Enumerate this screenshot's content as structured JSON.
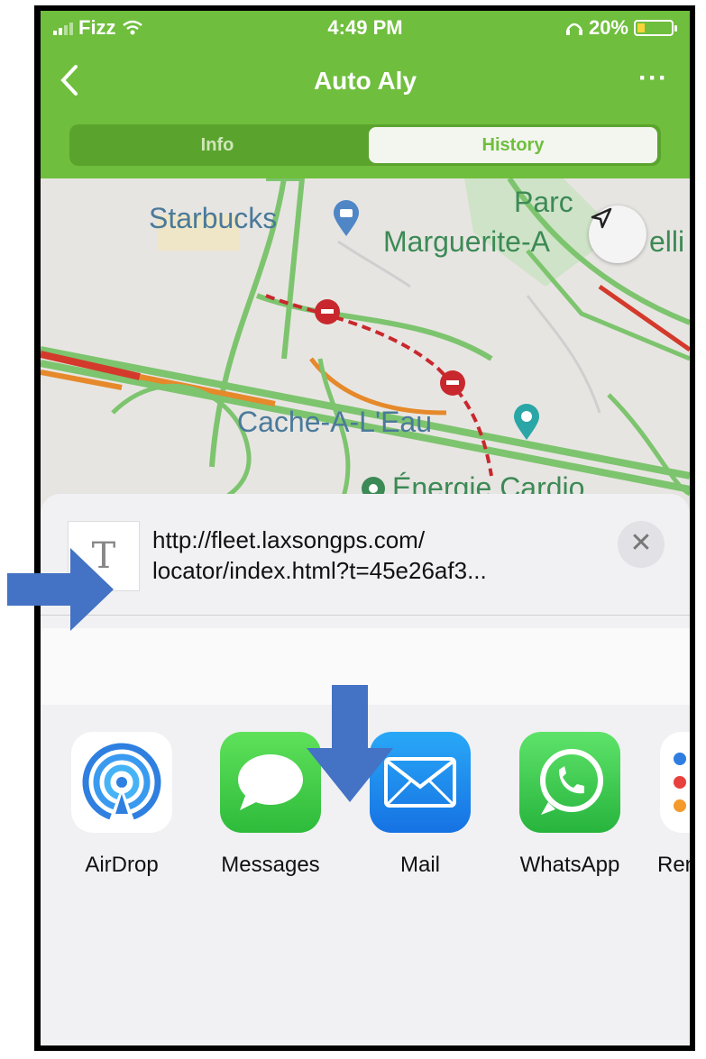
{
  "status_bar": {
    "carrier": "Fizz",
    "time": "4:49 PM",
    "battery": "20%"
  },
  "nav": {
    "back_glyph": "<",
    "title": "Auto Aly",
    "more_glyph": "···"
  },
  "segments": {
    "info": "Info",
    "history": "History"
  },
  "map": {
    "labels": {
      "starbucks": "Starbucks",
      "parc_line1": "Parc",
      "parc_line2": "Marguerite-A",
      "parc_line2_tail": "elli",
      "cache": "Cache-A-L'Eau",
      "energie": "Énergie Cardio"
    }
  },
  "share": {
    "thumb_glyph": "T",
    "url_line1": "http://fleet.laxsongps.com/",
    "url_line2": "locator/index.html?t=45e26af3...",
    "close_glyph": "✕",
    "apps": [
      {
        "label": "AirDrop",
        "icon": "airdrop-icon"
      },
      {
        "label": "Messages",
        "icon": "messages-icon"
      },
      {
        "label": "Mail",
        "icon": "mail-icon"
      },
      {
        "label": "WhatsApp",
        "icon": "whatsapp-icon"
      },
      {
        "label": "Ren",
        "icon": "reminders-icon"
      }
    ]
  },
  "colors": {
    "header_green": "#6fbe3d",
    "arrow_blue": "#4472c4",
    "route_red": "#c8282d"
  }
}
